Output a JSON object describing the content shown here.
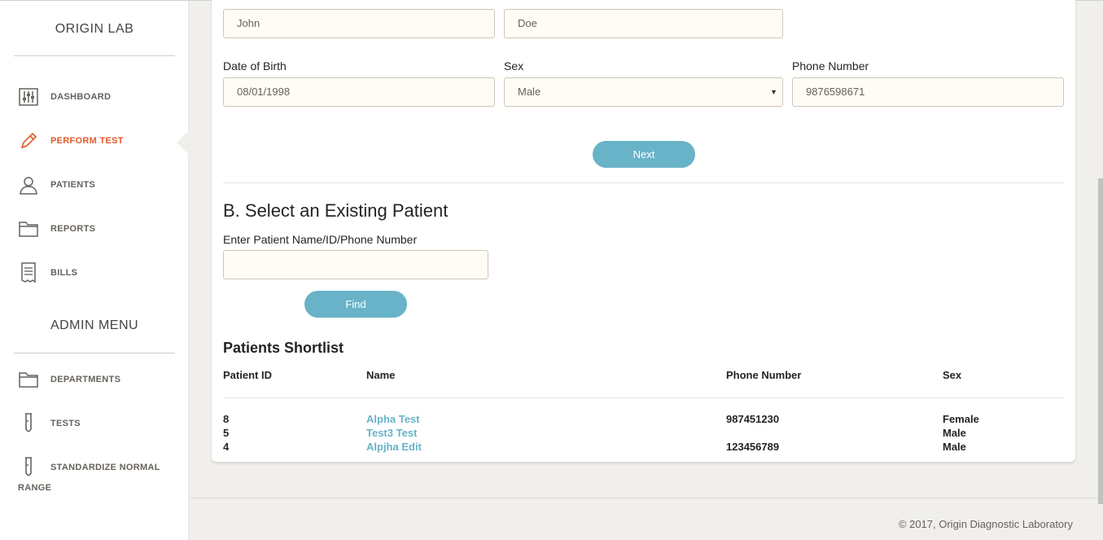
{
  "sidebar": {
    "brand": "ORIGIN LAB",
    "items": [
      {
        "label": "DASHBOARD",
        "icon": "sliders-icon"
      },
      {
        "label": "PERFORM TEST",
        "icon": "pencil-icon"
      },
      {
        "label": "PATIENTS",
        "icon": "user-icon"
      },
      {
        "label": "REPORTS",
        "icon": "folder-icon"
      },
      {
        "label": "BILLS",
        "icon": "receipt-icon"
      }
    ],
    "admin_title": "ADMIN MENU",
    "admin_items": [
      {
        "label": "DEPARTMENTS",
        "icon": "folder-icon"
      },
      {
        "label": "TESTS",
        "icon": "test-tube-icon"
      },
      {
        "label": "STANDARDIZE NORMAL",
        "label2": "RANGE",
        "icon": "test-tube-icon"
      }
    ],
    "active_color": "#e35b2a"
  },
  "form": {
    "first_name": "John",
    "last_name": "Doe",
    "dob_label": "Date of Birth",
    "dob_value": "08/01/1998",
    "sex_label": "Sex",
    "sex_value": "Male",
    "phone_label": "Phone Number",
    "phone_value": "9876598671",
    "next_label": "Next"
  },
  "existing": {
    "title": "B. Select an Existing Patient",
    "search_label": "Enter Patient Name/ID/Phone Number",
    "search_value": "",
    "find_label": "Find"
  },
  "shortlist": {
    "title": "Patients Shortlist",
    "columns": [
      "Patient ID",
      "Name",
      "Phone Number",
      "Sex"
    ],
    "rows": [
      {
        "id": "8",
        "name": "Alpha Test",
        "phone": "987451230",
        "sex": "Female"
      },
      {
        "id": "5",
        "name": "Test3 Test",
        "phone": "",
        "sex": "Male"
      },
      {
        "id": "4",
        "name": "Alpjha Edit",
        "phone": "123456789",
        "sex": "Male"
      }
    ]
  },
  "footer": {
    "text": "© 2017, Origin Diagnostic Laboratory"
  },
  "colors": {
    "accent": "#68b3c8",
    "active": "#e35b2a",
    "input_bg": "#fffcf5"
  }
}
